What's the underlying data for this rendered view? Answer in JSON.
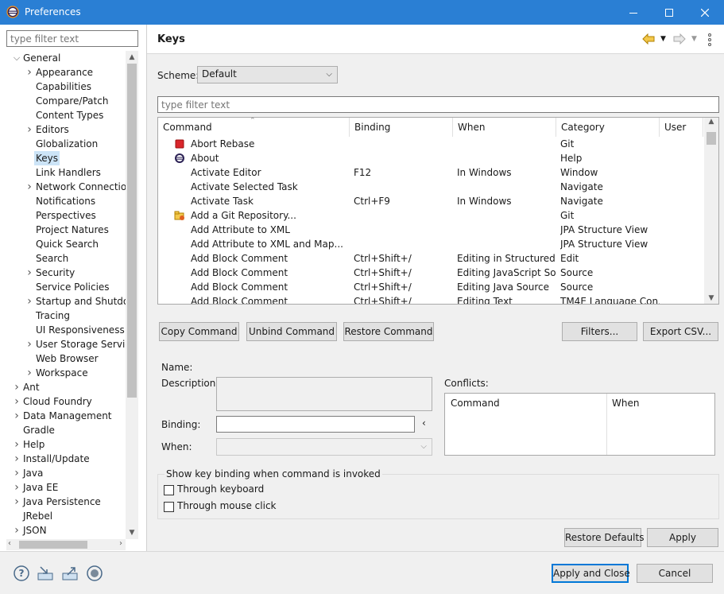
{
  "window": {
    "title": "Preferences"
  },
  "left": {
    "filter_placeholder": "type filter text",
    "tree": [
      {
        "label": "General",
        "arrow": "˅",
        "indent": 0
      },
      {
        "label": "Appearance",
        "arrow": "›",
        "indent": 1
      },
      {
        "label": "Capabilities",
        "arrow": "",
        "indent": 1
      },
      {
        "label": "Compare/Patch",
        "arrow": "",
        "indent": 1
      },
      {
        "label": "Content Types",
        "arrow": "",
        "indent": 1
      },
      {
        "label": "Editors",
        "arrow": "›",
        "indent": 1
      },
      {
        "label": "Globalization",
        "arrow": "",
        "indent": 1
      },
      {
        "label": "Keys",
        "arrow": "",
        "indent": 1,
        "selected": true
      },
      {
        "label": "Link Handlers",
        "arrow": "",
        "indent": 1
      },
      {
        "label": "Network Connection",
        "arrow": "›",
        "indent": 1
      },
      {
        "label": "Notifications",
        "arrow": "",
        "indent": 1
      },
      {
        "label": "Perspectives",
        "arrow": "",
        "indent": 1
      },
      {
        "label": "Project Natures",
        "arrow": "",
        "indent": 1
      },
      {
        "label": "Quick Search",
        "arrow": "",
        "indent": 1
      },
      {
        "label": "Search",
        "arrow": "",
        "indent": 1
      },
      {
        "label": "Security",
        "arrow": "›",
        "indent": 1
      },
      {
        "label": "Service Policies",
        "arrow": "",
        "indent": 1
      },
      {
        "label": "Startup and Shutdow",
        "arrow": "›",
        "indent": 1
      },
      {
        "label": "Tracing",
        "arrow": "",
        "indent": 1
      },
      {
        "label": "UI Responsiveness M",
        "arrow": "",
        "indent": 1
      },
      {
        "label": "User Storage Service",
        "arrow": "›",
        "indent": 1
      },
      {
        "label": "Web Browser",
        "arrow": "",
        "indent": 1
      },
      {
        "label": "Workspace",
        "arrow": "›",
        "indent": 1
      },
      {
        "label": "Ant",
        "arrow": "›",
        "indent": 0
      },
      {
        "label": "Cloud Foundry",
        "arrow": "›",
        "indent": 0
      },
      {
        "label": "Data Management",
        "arrow": "›",
        "indent": 0
      },
      {
        "label": "Gradle",
        "arrow": "",
        "indent": 0
      },
      {
        "label": "Help",
        "arrow": "›",
        "indent": 0
      },
      {
        "label": "Install/Update",
        "arrow": "›",
        "indent": 0
      },
      {
        "label": "Java",
        "arrow": "›",
        "indent": 0
      },
      {
        "label": "Java EE",
        "arrow": "›",
        "indent": 0
      },
      {
        "label": "Java Persistence",
        "arrow": "›",
        "indent": 0
      },
      {
        "label": "JRebel",
        "arrow": "",
        "indent": 0
      },
      {
        "label": "JSON",
        "arrow": "›",
        "indent": 0
      }
    ]
  },
  "page": {
    "title": "Keys",
    "scheme_label": "Scheme:",
    "scheme_value": "Default",
    "filter_placeholder": "type filter text",
    "columns": [
      "Command",
      "Binding",
      "When",
      "Category",
      "User"
    ],
    "rows": [
      {
        "icon": "red-square",
        "command": "Abort Rebase",
        "binding": "",
        "when": "",
        "category": "Git"
      },
      {
        "icon": "eclipse-logo",
        "command": "About",
        "binding": "",
        "when": "",
        "category": "Help"
      },
      {
        "icon": "",
        "command": "Activate Editor",
        "binding": "F12",
        "when": "In Windows",
        "category": "Window"
      },
      {
        "icon": "",
        "command": "Activate Selected Task",
        "binding": "",
        "when": "",
        "category": "Navigate"
      },
      {
        "icon": "",
        "command": "Activate Task",
        "binding": "Ctrl+F9",
        "when": "In Windows",
        "category": "Navigate"
      },
      {
        "icon": "git-repo",
        "command": "Add a Git Repository...",
        "binding": "",
        "when": "",
        "category": "Git"
      },
      {
        "icon": "",
        "command": "Add Attribute to XML",
        "binding": "",
        "when": "",
        "category": "JPA Structure View"
      },
      {
        "icon": "",
        "command": "Add Attribute to XML and Map...",
        "binding": "",
        "when": "",
        "category": "JPA Structure View"
      },
      {
        "icon": "",
        "command": "Add Block Comment",
        "binding": "Ctrl+Shift+/",
        "when": "Editing in Structured...",
        "category": "Edit"
      },
      {
        "icon": "",
        "command": "Add Block Comment",
        "binding": "Ctrl+Shift+/",
        "when": "Editing JavaScript So...",
        "category": "Source"
      },
      {
        "icon": "",
        "command": "Add Block Comment",
        "binding": "Ctrl+Shift+/",
        "when": "Editing Java Source",
        "category": "Source"
      },
      {
        "icon": "",
        "command": "Add Block Comment",
        "binding": "Ctrl+Shift+/",
        "when": "Editing Text",
        "category": "TM4E Language Con..."
      }
    ],
    "buttons": {
      "copy": "Copy Command",
      "unbind": "Unbind Command",
      "restore": "Restore Command",
      "filters": "Filters...",
      "export": "Export CSV..."
    },
    "details": {
      "name_label": "Name:",
      "description_label": "Description:",
      "binding_label": "Binding:",
      "when_label": "When:",
      "binding_value": "",
      "conflicts_label": "Conflicts:",
      "conflicts_columns": [
        "Command",
        "When"
      ]
    },
    "show_binding": {
      "label": "Show key binding when command is invoked",
      "keyboard": "Through keyboard",
      "mouse": "Through mouse click"
    },
    "restore_defaults": "Restore Defaults",
    "apply": "Apply"
  },
  "footer": {
    "apply_close": "Apply and Close",
    "cancel": "Cancel",
    "icons": [
      "help-icon",
      "import-icon",
      "export-icon",
      "record-icon"
    ]
  }
}
